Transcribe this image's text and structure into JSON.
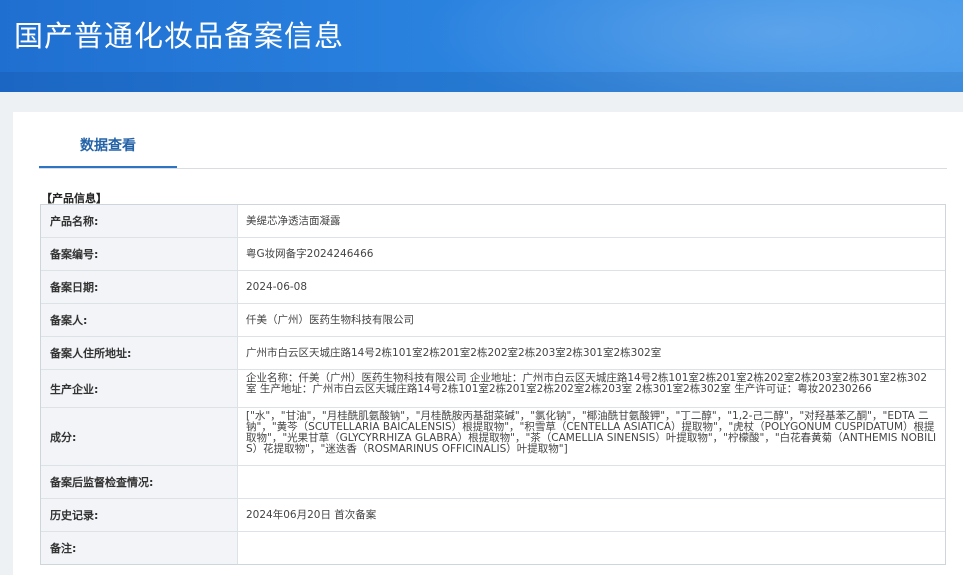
{
  "header": {
    "title": "国产普通化妆品备案信息"
  },
  "tabs": {
    "active_label": "数据查看"
  },
  "section": {
    "title": "【产品信息】"
  },
  "fields": [
    {
      "label": "产品名称:",
      "value": "美缇芯净透洁面凝露"
    },
    {
      "label": "备案编号:",
      "value": "粤G妆网备字2024246466"
    },
    {
      "label": "备案日期:",
      "value": "2024-06-08"
    },
    {
      "label": "备案人:",
      "value": "仟美（广州）医药生物科技有限公司"
    },
    {
      "label": "备案人住所地址:",
      "value": "广州市白云区天城庄路14号2栋101室2栋201室2栋202室2栋203室2栋301室2栋302室"
    },
    {
      "label": "生产企业:",
      "value": "企业名称：仟美（广州）医药生物科技有限公司 企业地址：广州市白云区天城庄路14号2栋101室2栋201室2栋202室2栋203室2栋301室2栋302室 生产地址：广州市白云区天城庄路14号2栋101室2栋201室2栋202室2栋203室 2栋301室2栋302室 生产许可证：粤妆20230266"
    },
    {
      "label": "成分:",
      "value": "[\"水\"，\"甘油\"，\"月桂酰肌氨酸钠\"，\"月桂酰胺丙基甜菜碱\"，\"氯化钠\"，\"椰油酰甘氨酸钾\"，\"丁二醇\"，\"1,2-己二醇\"，\"对羟基苯乙酮\"，\"EDTA 二钠\"，\"黄芩（SCUTELLARIA BAICALENSIS）根提取物\"，\"积雪草（CENTELLA ASIATICA）提取物\"，\"虎杖（POLYGONUM CUSPIDATUM）根提取物\"，\"光果甘草（GLYCYRRHIZA GLABRA）根提取物\"，\"茶（CAMELLIA SINENSIS）叶提取物\"，\"柠檬酸\"，\"白花春黄菊（ANTHEMIS NOBILIS）花提取物\"，\"迷迭香（ROSMARINUS OFFICINALIS）叶提取物\"]"
    },
    {
      "label": "备案后监督检查情况:",
      "value": ""
    },
    {
      "label": "历史记录:",
      "value": "2024年06月20日 首次备案"
    },
    {
      "label": "备注:",
      "value": ""
    }
  ],
  "colors": {
    "header_blue": "#2a82df",
    "tab_accent": "#2e74c5",
    "label_bg": "#f2f4f7"
  }
}
